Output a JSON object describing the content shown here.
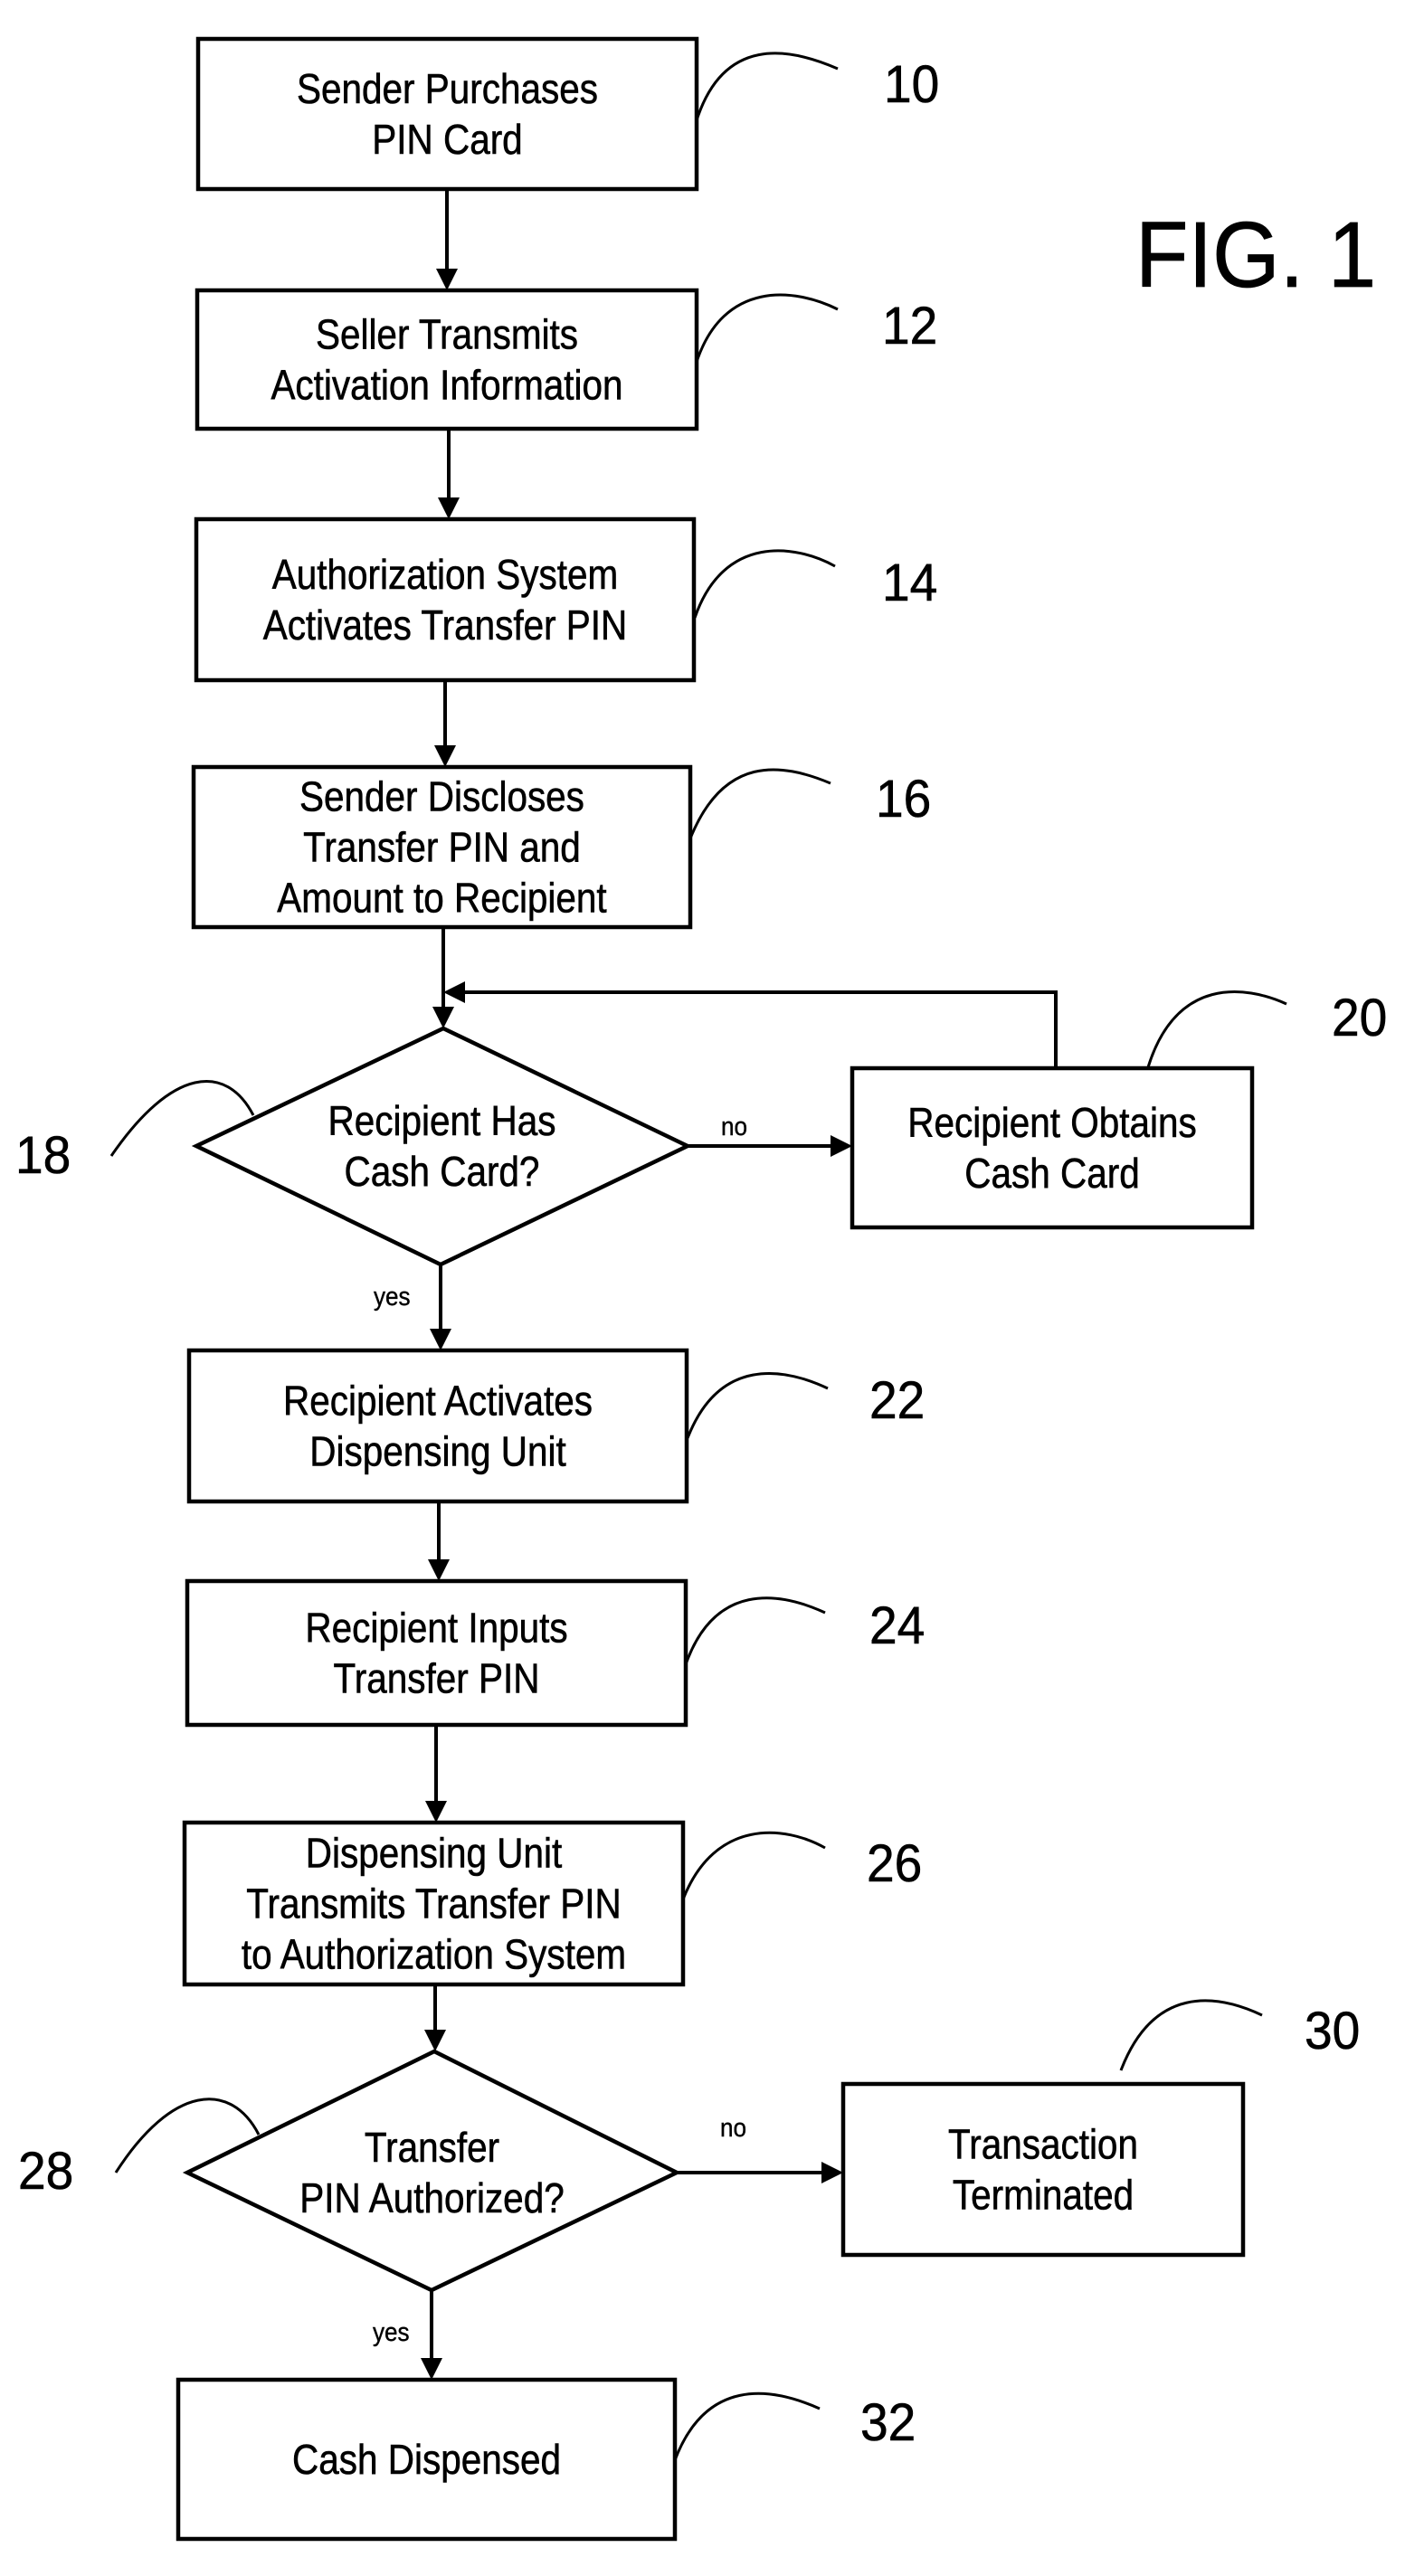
{
  "figure": {
    "title": "FIG. 1"
  },
  "nodes": {
    "n10": {
      "ref": "10",
      "type": "process",
      "lines": [
        "Sender Purchases",
        "PIN Card"
      ]
    },
    "n12": {
      "ref": "12",
      "type": "process",
      "lines": [
        "Seller Transmits",
        "Activation Information"
      ]
    },
    "n14": {
      "ref": "14",
      "type": "process",
      "lines": [
        "Authorization System",
        "Activates Transfer PIN"
      ]
    },
    "n16": {
      "ref": "16",
      "type": "process",
      "lines": [
        "Sender Discloses",
        "Transfer PIN and",
        "Amount to Recipient"
      ]
    },
    "n18": {
      "ref": "18",
      "type": "decision",
      "lines": [
        "Recipient Has",
        "Cash Card?"
      ]
    },
    "n20": {
      "ref": "20",
      "type": "process",
      "lines": [
        "Recipient Obtains",
        "Cash Card"
      ]
    },
    "n22": {
      "ref": "22",
      "type": "process",
      "lines": [
        "Recipient Activates",
        "Dispensing Unit"
      ]
    },
    "n24": {
      "ref": "24",
      "type": "process",
      "lines": [
        "Recipient Inputs",
        "Transfer PIN"
      ]
    },
    "n26": {
      "ref": "26",
      "type": "process",
      "lines": [
        "Dispensing Unit",
        "Transmits Transfer PIN",
        "to Authorization System"
      ]
    },
    "n28": {
      "ref": "28",
      "type": "decision",
      "lines": [
        "Transfer",
        "PIN Authorized?"
      ]
    },
    "n30": {
      "ref": "30",
      "type": "process",
      "lines": [
        "Transaction",
        "Terminated"
      ]
    },
    "n32": {
      "ref": "32",
      "type": "process",
      "lines": [
        "Cash Dispensed"
      ]
    }
  },
  "edges": [
    {
      "from": "n10",
      "to": "n12",
      "label": ""
    },
    {
      "from": "n12",
      "to": "n14",
      "label": ""
    },
    {
      "from": "n14",
      "to": "n16",
      "label": ""
    },
    {
      "from": "n16",
      "to": "n18",
      "label": ""
    },
    {
      "from": "n18",
      "to": "n20",
      "label": "no"
    },
    {
      "from": "n20",
      "to": "n18",
      "label": ""
    },
    {
      "from": "n18",
      "to": "n22",
      "label": "yes"
    },
    {
      "from": "n22",
      "to": "n24",
      "label": ""
    },
    {
      "from": "n24",
      "to": "n26",
      "label": ""
    },
    {
      "from": "n26",
      "to": "n28",
      "label": ""
    },
    {
      "from": "n28",
      "to": "n30",
      "label": "no"
    },
    {
      "from": "n28",
      "to": "n32",
      "label": "yes"
    }
  ]
}
